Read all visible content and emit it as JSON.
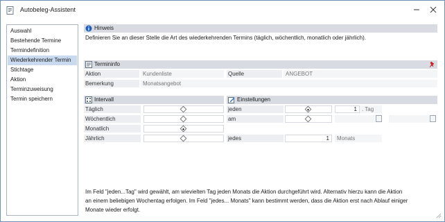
{
  "window": {
    "title": "Autobeleg-Assistent"
  },
  "sidebar": {
    "items": [
      {
        "label": "Auswahl"
      },
      {
        "label": "Bestehende Termine"
      },
      {
        "label": "Termindefinition"
      },
      {
        "label": "Wiederkehrender Termin"
      },
      {
        "label": "Stichtage"
      },
      {
        "label": "Aktion"
      },
      {
        "label": "Terminzuweisung"
      },
      {
        "label": "Termin speichern"
      }
    ]
  },
  "hinweis": {
    "title": "Hinweis",
    "text": "Definieren Sie an dieser Stelle die Art des wiederkehrenden Termins (täglich, wöchentlich, monatlich oder jährlich)."
  },
  "termininfo": {
    "title": "Termininfo",
    "aktion_label": "Aktion",
    "aktion_value": "Kundenliste",
    "quelle_label": "Quelle",
    "quelle_value": "ANGEBOT",
    "bemerkung_label": "Bemerkung",
    "bemerkung_value": "Monatsangebot"
  },
  "intervall": {
    "title": "Intervall",
    "options": [
      {
        "label": "Täglich",
        "selected": false
      },
      {
        "label": "Wöchentlich",
        "selected": false
      },
      {
        "label": "Monatlich",
        "selected": true
      },
      {
        "label": "Jährlich",
        "selected": false
      }
    ]
  },
  "einstellungen": {
    "title": "Einstellungen",
    "jeden_label": "jeden",
    "jeden_selected": true,
    "jeden_value": "1",
    "jeden_unit": ". Tag",
    "am_label": "am",
    "am_selected": false,
    "jedes_label": "jedes",
    "jedes_value": "1",
    "jedes_unit": "Monats"
  },
  "footer": {
    "line1": "Im Feld \"jeden...Tag\" wird gewählt, am wievielten Tag jeden Monats die Aktion durchgeführt wird. Alternativ hierzu kann die Aktion",
    "line2": "an einem beliebigen Wochentag erfolgen. Im Feld \"jedes... Monats\" kann bestimmt werden, dass die Aktion erst nach Ablauf einiger",
    "line3": "Monate wieder erfolgt."
  },
  "colors": {
    "accent": "#c9daf0",
    "section_bar": "#d8dce2",
    "info_icon": "#1f5fbf"
  }
}
